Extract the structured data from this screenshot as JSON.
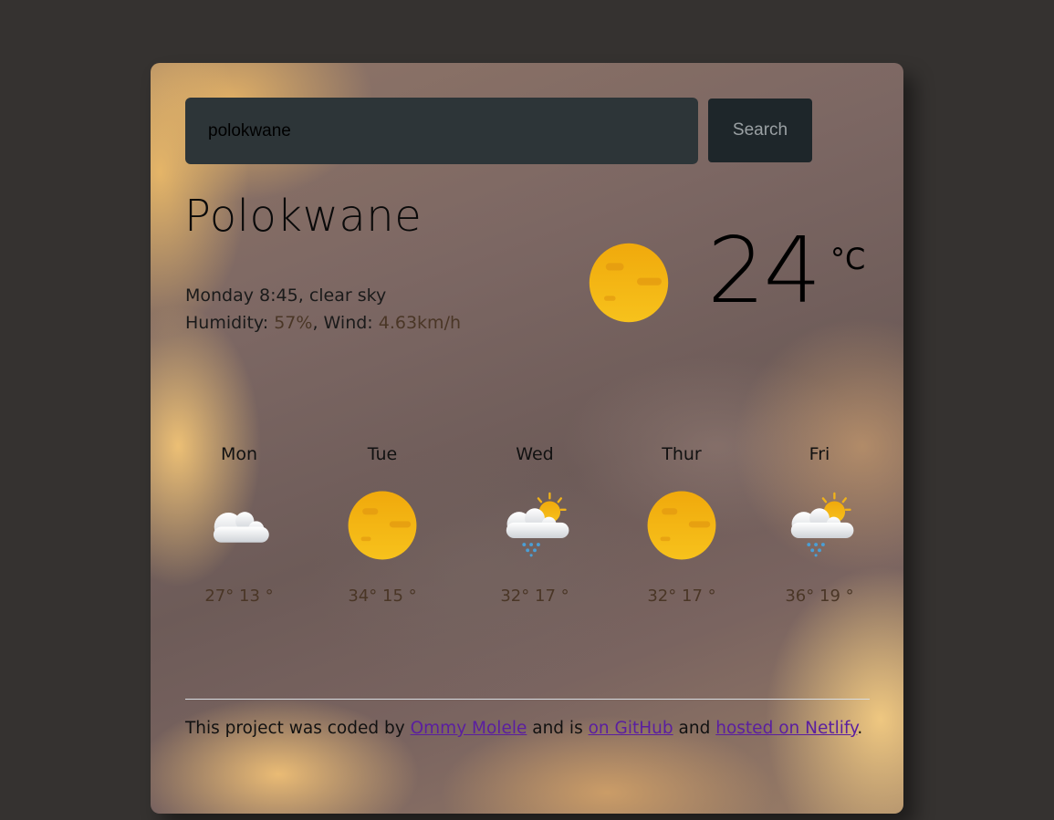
{
  "search": {
    "value": "polokwane",
    "button_label": "Search"
  },
  "current": {
    "city": "Polokwane",
    "day_time": "Monday 8:45",
    "description": "clear sky",
    "humidity_label": "Humidity:",
    "humidity_value": "57%",
    "wind_label": "Wind:",
    "wind_value": "4.63km/h",
    "temperature": "24",
    "unit": "°C",
    "icon": "sun-icon"
  },
  "forecast": [
    {
      "day": "Mon",
      "max": "27°",
      "min": "13 °",
      "icon": "cloud-icon"
    },
    {
      "day": "Tue",
      "max": "34°",
      "min": "15 °",
      "icon": "sun-icon"
    },
    {
      "day": "Wed",
      "max": "32°",
      "min": "17 °",
      "icon": "sun-cloud-rain-icon"
    },
    {
      "day": "Thur",
      "max": "32°",
      "min": "17 °",
      "icon": "sun-icon"
    },
    {
      "day": "Fri",
      "max": "36°",
      "min": "19 °",
      "icon": "sun-cloud-rain-icon"
    }
  ],
  "footer": {
    "prefix": "This project was coded by",
    "author_link": "Ommy Molele",
    "middle": "and is",
    "github_link": "on GitHub",
    "and": "and",
    "hosted_link": "hosted on Netlify",
    "suffix": "."
  },
  "colors": {
    "page_background": "#353230",
    "input_background": "#2d3538",
    "button_background": "#1e262a",
    "link": "#5a1ea0",
    "sun": "#f5b814"
  }
}
